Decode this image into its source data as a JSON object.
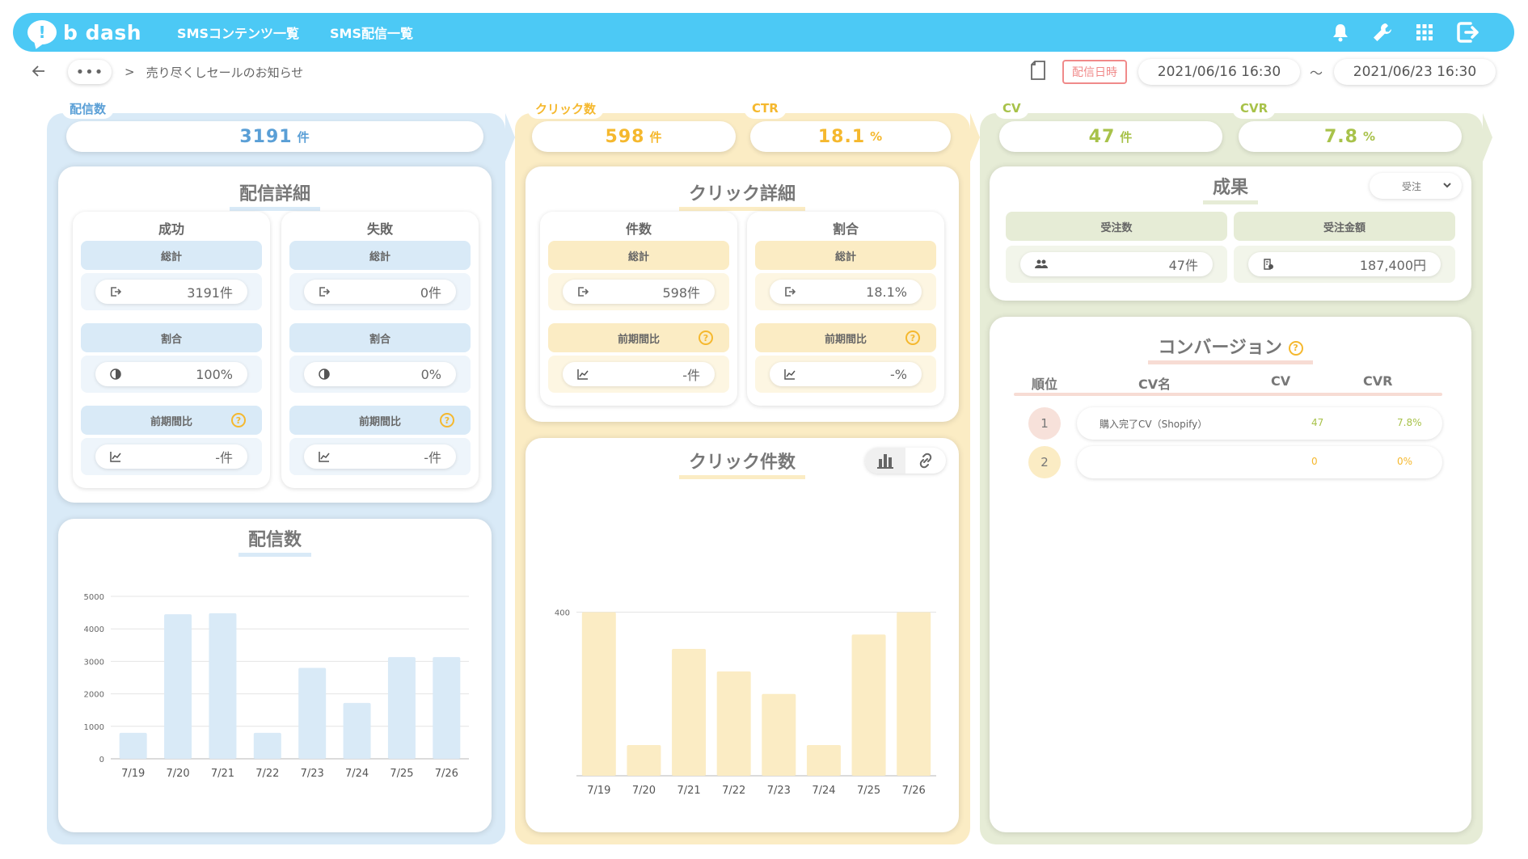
{
  "header": {
    "logo_text": "b dash",
    "nav": [
      "SMSコンテンツ一覧",
      "SMS配信一覧"
    ],
    "icons": [
      "bell-icon",
      "wrench-icon",
      "grid-icon",
      "logout-icon"
    ],
    "accent": "#4cc9f5"
  },
  "subbar": {
    "dots": "•••",
    "sep": ">",
    "breadcrumb": "売り尽くしセールのお知らせ",
    "date_label": "配信日時",
    "date_from": "2021/06/16 16:30",
    "tilde": "～",
    "date_to": "2021/06/23 16:30"
  },
  "kpis": {
    "delivery": {
      "label": "配信数",
      "value": "3191",
      "unit": "件"
    },
    "click": {
      "label": "クリック数",
      "value": "598",
      "unit": "件"
    },
    "ctr": {
      "label": "CTR",
      "value": "18.1",
      "unit": "%"
    },
    "cv": {
      "label": "CV",
      "value": "47",
      "unit": "件"
    },
    "cvr": {
      "label": "CVR",
      "value": "7.8",
      "unit": "%"
    }
  },
  "delivery_detail": {
    "title": "配信詳細",
    "success": {
      "head": "成功",
      "total_label": "総計",
      "total": "3191件",
      "ratio_label": "割合",
      "ratio": "100%",
      "prev_label": "前期間比",
      "prev": "-件"
    },
    "fail": {
      "head": "失敗",
      "total_label": "総計",
      "total": "0件",
      "ratio_label": "割合",
      "ratio": "0%",
      "prev_label": "前期間比",
      "prev": "-件"
    },
    "help": "?"
  },
  "click_detail": {
    "title": "クリック詳細",
    "count": {
      "head": "件数",
      "total_label": "総計",
      "total": "598件",
      "prev_label": "前期間比",
      "prev": "-件"
    },
    "ratio": {
      "head": "割合",
      "total_label": "総計",
      "total": "18.1%",
      "prev_label": "前期間比",
      "prev": "-%"
    }
  },
  "result": {
    "title": "成果",
    "select": "受注",
    "orders_label": "受注数",
    "orders": "47件",
    "amount_label": "受注金額",
    "amount": "187,400円"
  },
  "conversion": {
    "title": "コンバージョン",
    "help": "?",
    "headers": [
      "順位",
      "CV名",
      "CV",
      "CVR"
    ],
    "rows": [
      {
        "rank": "1",
        "name": "購入完了CV（Shopify）",
        "cv": "47",
        "cvr": "7.8%"
      },
      {
        "rank": "2",
        "name": "",
        "cv": "0",
        "cvr": "0%"
      }
    ]
  },
  "chart_data": [
    {
      "type": "bar",
      "title": "配信数",
      "categories": [
        "7/19",
        "7/20",
        "7/21",
        "7/22",
        "7/23",
        "7/24",
        "7/25",
        "7/26"
      ],
      "values": [
        800,
        4450,
        4480,
        800,
        2800,
        1720,
        3130,
        3130
      ],
      "yticks": [
        0,
        1000,
        2000,
        3000,
        4000,
        5000
      ],
      "ylim": [
        0,
        5000
      ],
      "grid": true,
      "color": "#d9eaf7"
    },
    {
      "type": "bar",
      "title": "クリック件数",
      "categories": [
        "7/19",
        "7/20",
        "7/21",
        "7/22",
        "7/23",
        "7/24",
        "7/25",
        "7/26"
      ],
      "values": [
        400,
        75,
        310,
        255,
        200,
        75,
        345,
        400
      ],
      "yticks": [
        400
      ],
      "ylim": [
        0,
        470
      ],
      "grid": true,
      "color": "#fbecc4"
    }
  ]
}
